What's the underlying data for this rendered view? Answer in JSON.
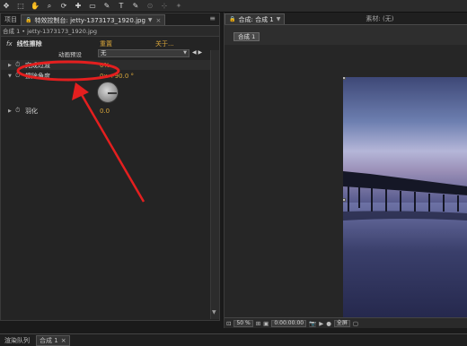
{
  "toolbar": {
    "tools": [
      "✥",
      "⬚",
      "✋",
      "⌕",
      "⟳",
      "✚",
      "▭",
      "✎",
      "T",
      "✎",
      "⊙",
      "⊹",
      "✦"
    ]
  },
  "effect_controls": {
    "project_tab": "项目",
    "tab_label": "特效控制台: jetty-1373173_1920.jpg",
    "close": "×",
    "menu": "≡",
    "comp_path": "合成 1 • jetty-1373173_1920.jpg",
    "effect_name": "线性擦除",
    "fx": "fx",
    "reset": "重置",
    "about": "关于...",
    "animation_label": "动画预设",
    "animation_value": "无",
    "properties": [
      {
        "name": "完成过渡",
        "value": "0%"
      },
      {
        "name": "擦除角度",
        "value": "0x +90.0 °"
      },
      {
        "name": "羽化",
        "value": "0.0"
      }
    ]
  },
  "composition": {
    "tab_label": "合成: 合成 1",
    "footage_tab": "素材: (无)",
    "chip": "合成 1",
    "footer": {
      "zoom": "50 %",
      "timecode": "0:00:00:00",
      "view": "全屏"
    }
  },
  "bottom": {
    "tabs": [
      "渲染队列",
      "合成 1"
    ]
  }
}
